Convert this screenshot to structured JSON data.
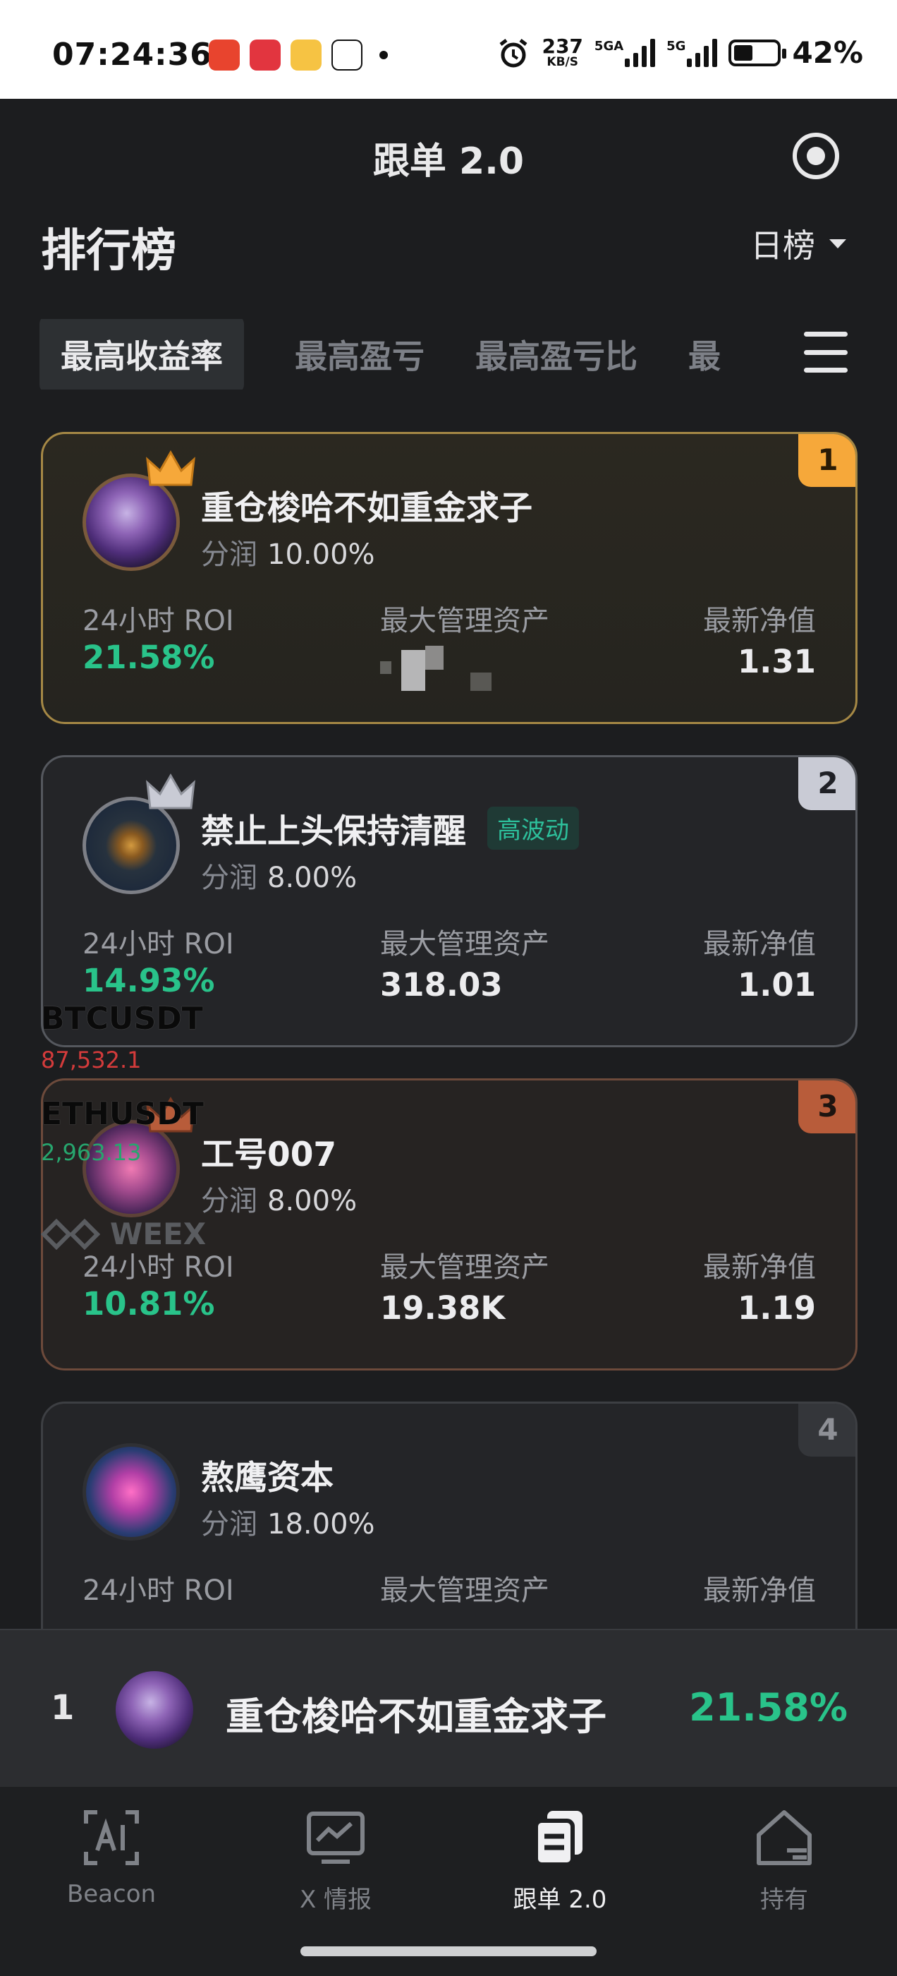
{
  "status_bar": {
    "time": "07:24:36",
    "net_speed": "237",
    "net_unit": "KB/S",
    "sim1": "5GA",
    "sim2": "5G",
    "battery": "42%",
    "app_icons": [
      "taobao-icon",
      "hongbao-icon",
      "weibo-icon",
      "qq-icon"
    ]
  },
  "header": {
    "title": "跟单 2.0",
    "settings_icon": "target-icon"
  },
  "leaderboard": {
    "title": "排行榜",
    "period": "日榜"
  },
  "tabs": [
    {
      "label": "最高收益率",
      "active": true
    },
    {
      "label": "最高盈亏",
      "active": false
    },
    {
      "label": "最高盈亏比",
      "active": false
    },
    {
      "label": "最",
      "active": false
    }
  ],
  "labels": {
    "share": "分润",
    "roi": "24小时 ROI",
    "aum": "最大管理资产",
    "nav": "最新净值"
  },
  "traders": [
    {
      "rank": "1",
      "name": "重仓梭哈不如重金求子",
      "share": "10.00%",
      "roi": "21.58%",
      "aum": "",
      "nav": "1.31",
      "tag": ""
    },
    {
      "rank": "2",
      "name": "禁止上头保持清醒",
      "share": "8.00%",
      "roi": "14.93%",
      "aum": "318.03",
      "nav": "1.01",
      "tag": "高波动"
    },
    {
      "rank": "3",
      "name": "工号007",
      "share": "8.00%",
      "roi": "10.81%",
      "aum": "19.38K",
      "nav": "1.19",
      "tag": ""
    },
    {
      "rank": "4",
      "name": "熬鹰资本",
      "share": "18.00%",
      "roi": "",
      "aum": "",
      "nav": "",
      "tag": ""
    }
  ],
  "ticker_overlay": {
    "symbol1": "BTCUSDT",
    "price1": "87,532.1",
    "symbol2": "ETHUSDT",
    "price2": "2,963.13",
    "brand": "WEEX"
  },
  "mini_bar": {
    "rank": "1",
    "name": "重仓梭哈不如重金求子",
    "roi": "21.58%"
  },
  "bottom_nav": [
    {
      "label": "Beacon",
      "icon": "ai-icon",
      "active": false
    },
    {
      "label": "X 情报",
      "icon": "chart-monitor-icon",
      "active": false
    },
    {
      "label": "跟单 2.0",
      "icon": "copy-trade-icon",
      "active": true
    },
    {
      "label": "持有",
      "icon": "house-icon",
      "active": false
    }
  ],
  "colors": {
    "background": "#1c1d1f",
    "positive": "#29c38a",
    "gold": "#f6a83a",
    "silver": "#c9cbd5",
    "bronze": "#b85c3a"
  }
}
